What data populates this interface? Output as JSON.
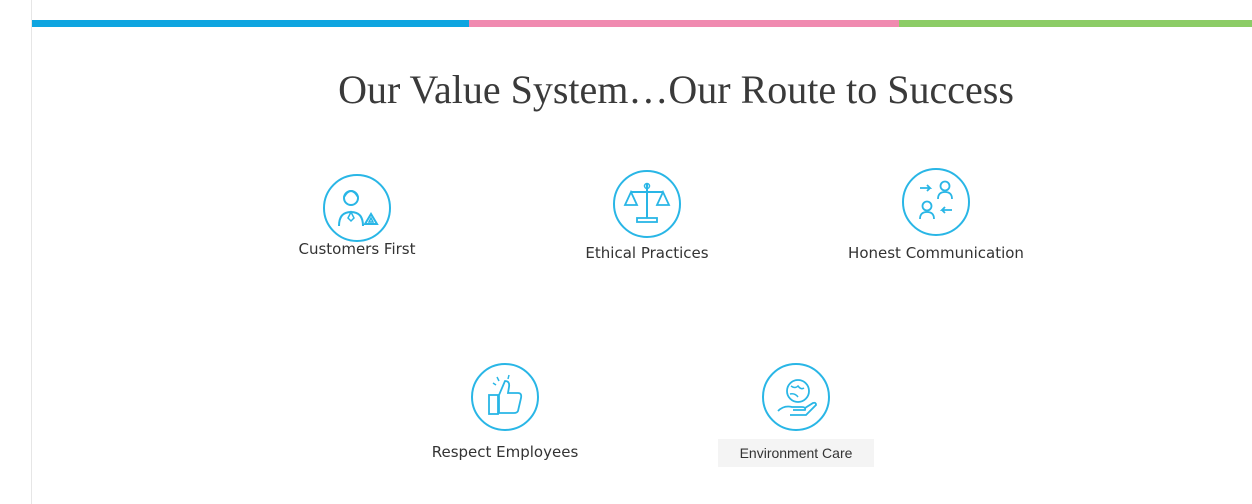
{
  "header": {
    "stripe_colors": [
      "#0ea5e0",
      "#f08ab0",
      "#8ccc66"
    ]
  },
  "title": "Our Value System…Our Route to Success",
  "icon_color": "#29b6e6",
  "values": [
    {
      "label": "Customers First",
      "icon": "customer-support-icon"
    },
    {
      "label": "Ethical Practices",
      "icon": "scales-of-justice-icon"
    },
    {
      "label": "Honest Communication",
      "icon": "people-exchange-icon"
    },
    {
      "label": "Respect Employees",
      "icon": "thumbs-up-icon"
    },
    {
      "label": "Environment Care",
      "icon": "hand-holding-globe-icon"
    }
  ]
}
